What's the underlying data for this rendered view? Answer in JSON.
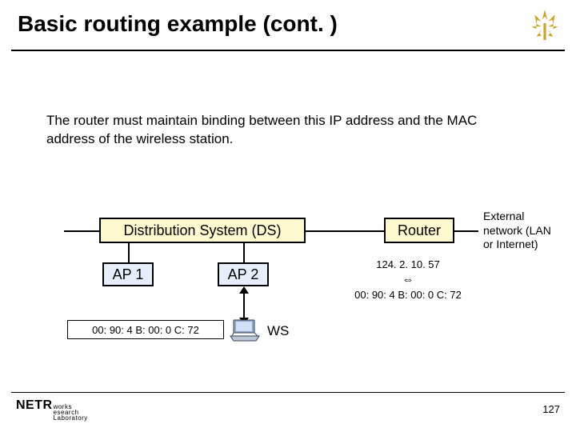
{
  "title": "Basic routing example (cont. )",
  "description": "The router must maintain binding between this IP address and the MAC address of the wireless station.",
  "diagram": {
    "ds_label": "Distribution System (DS)",
    "router_label": "Router",
    "ap1_label": "AP 1",
    "ap2_label": "AP 2",
    "ws_label": "WS",
    "mac_address": "00: 90: 4 B: 00: 0 C: 72",
    "external_network_label": "External network (LAN or Internet)",
    "binding_ip": "124. 2. 10. 57",
    "binding_symbol": "⇔",
    "binding_mac": "00: 90: 4 B: 00: 0 C: 72"
  },
  "footer": {
    "logo_main": "NETR",
    "logo_sub1": "works",
    "logo_sub2": "esearch",
    "logo_sub3": "Laboratory",
    "page": "127"
  }
}
